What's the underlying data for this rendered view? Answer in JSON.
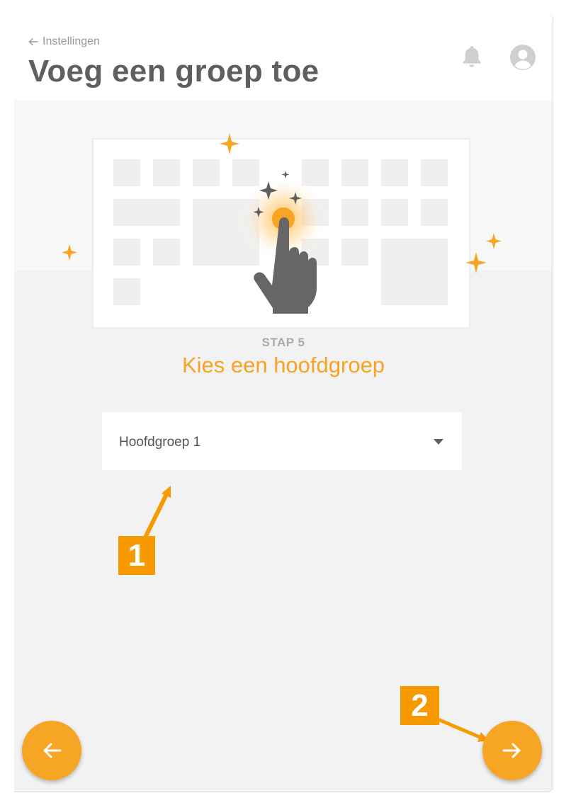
{
  "header": {
    "back_label": "Instellingen",
    "title": "Voeg een groep toe",
    "icons": [
      "arrow-left-icon",
      "bell-icon",
      "user-avatar-icon"
    ]
  },
  "step": {
    "label": "STAP 5",
    "title": "Kies een hoofdgroep"
  },
  "main_group_select": {
    "value": "Hoofdgroep 1"
  },
  "navigation": {
    "back_icon": "arrow-left-icon",
    "next_icon": "arrow-right-icon"
  },
  "annotations": {
    "badge_1": "1",
    "badge_2": "2"
  },
  "colors": {
    "accent": "#f7a525",
    "annotation": "#f79a00",
    "title_text": "#5f5f5f",
    "muted_text": "#9a9a9a",
    "background": "#f2f2f2"
  }
}
